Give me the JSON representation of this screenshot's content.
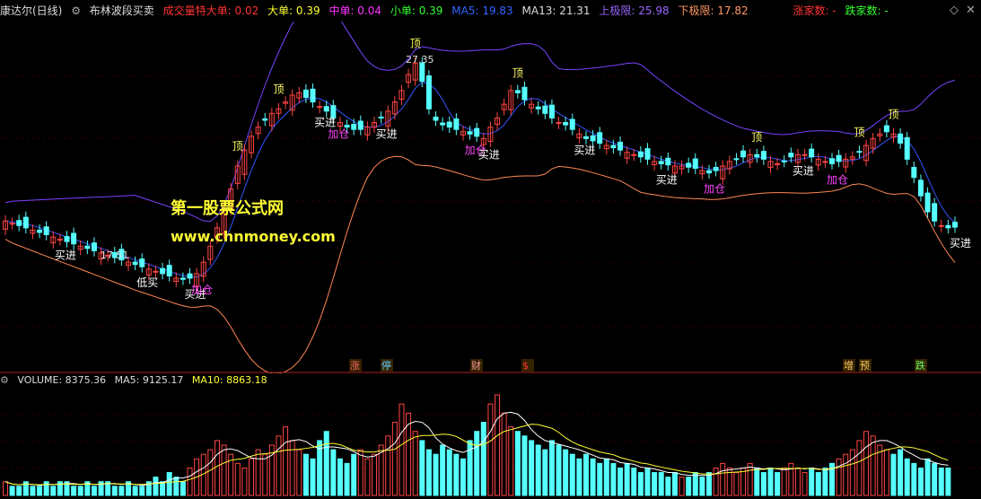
{
  "header": {
    "title": "康达尔(日线)",
    "formula": "布林波段买卖",
    "extra_large": "成交量特大单: 0.02",
    "large": "大单: 0.39",
    "medium": "中单: 0.04",
    "small": "小单: 0.39",
    "ma5": "MA5: 19.83",
    "ma13": "MA13: 21.31",
    "upper": "上极限: 25.98",
    "lower": "下极限: 17.82",
    "up_count": "涨家数: -",
    "down_count": "跌家数: -",
    "colors": {
      "title": "#dddddd",
      "extra_large": "#ff3333",
      "large": "#ffff33",
      "medium": "#ff33ff",
      "small": "#33ff33",
      "ma5": "#3366ff",
      "ma13": "#dddddd",
      "upper": "#9966ff",
      "lower": "#ff9966",
      "up_count": "#ff3333",
      "down_count": "#33ff33"
    }
  },
  "watermark": {
    "line1": "第一股票公式网",
    "line2": "www.chnmoney.com"
  },
  "price_labels": {
    "high": "27.35",
    "low": "17.51"
  },
  "signals": {
    "top": "顶",
    "buy": "买进",
    "add": "加仓",
    "low_buy": "低买"
  },
  "event_markers": [
    "涨",
    "停",
    "财",
    "$",
    "增",
    "预",
    "跌"
  ],
  "volume_header": {
    "volume": "VOLUME: 8375.36",
    "ma5": "MA5: 9125.17",
    "ma10": "MA10: 8863.18"
  },
  "chart_data": {
    "type": "candlestick",
    "closes": [
      20.1,
      20.0,
      19.9,
      19.8,
      19.7,
      19.6,
      19.5,
      19.4,
      19.3,
      19.2,
      19.1,
      19.0,
      18.9,
      18.8,
      18.7,
      18.6,
      18.5,
      18.4,
      18.3,
      18.2,
      18.1,
      18.0,
      17.9,
      17.8,
      17.7,
      17.6,
      17.55,
      17.6,
      17.8,
      18.3,
      19.0,
      19.8,
      20.6,
      21.5,
      22.5,
      23.2,
      23.8,
      24.2,
      24.5,
      24.8,
      25.0,
      25.3,
      25.6,
      25.7,
      25.5,
      25.3,
      25.1,
      24.9,
      24.6,
      24.4,
      24.2,
      24.1,
      24.1,
      24.2,
      24.4,
      24.6,
      24.9,
      25.3,
      25.8,
      26.5,
      27.0,
      26.2,
      25.0,
      24.5,
      24.3,
      24.2,
      24.1,
      24.0,
      23.9,
      23.8,
      23.7,
      24.2,
      24.6,
      25.2,
      25.8,
      25.7,
      25.4,
      25.2,
      25.0,
      24.8,
      24.6,
      24.4,
      24.3,
      24.1,
      23.9,
      23.7,
      23.6,
      23.5,
      23.4,
      23.3,
      23.2,
      23.1,
      23.0,
      22.9,
      22.8,
      22.7,
      22.6,
      22.55,
      22.5,
      22.5,
      22.45,
      22.4,
      22.3,
      22.2,
      22.3,
      22.5,
      22.7,
      22.8,
      22.9,
      23.0,
      22.9,
      22.8,
      22.7,
      22.6,
      22.7,
      22.9,
      23.0,
      23.0,
      22.9,
      22.8,
      22.7,
      22.6,
      22.7,
      22.8,
      22.9,
      23.1,
      23.4,
      23.7,
      23.9,
      24.0,
      23.9,
      23.5,
      22.8,
      22.0,
      21.2,
      20.5,
      20.1,
      19.9,
      19.8,
      19.83
    ],
    "volumes": [
      3,
      2,
      2,
      3,
      2,
      2,
      3,
      2,
      3,
      3,
      2,
      2,
      3,
      2,
      3,
      3,
      2,
      2,
      3,
      2,
      2,
      3,
      4,
      3,
      5,
      4,
      3,
      6,
      8,
      9,
      10,
      12,
      11,
      9,
      7,
      6,
      8,
      10,
      9,
      11,
      13,
      15,
      12,
      10,
      9,
      8,
      12,
      14,
      10,
      8,
      7,
      9,
      10,
      8,
      9,
      11,
      13,
      16,
      20,
      18,
      14,
      12,
      10,
      9,
      11,
      10,
      9,
      8,
      12,
      14,
      16,
      20,
      22,
      18,
      15,
      14,
      13,
      12,
      11,
      10,
      12,
      11,
      10,
      9,
      8,
      9,
      8,
      7,
      8,
      7,
      6,
      7,
      6,
      5,
      6,
      5,
      5,
      4,
      5,
      4,
      4,
      5,
      4,
      5,
      6,
      7,
      6,
      5,
      6,
      7,
      6,
      5,
      6,
      5,
      6,
      7,
      6,
      5,
      6,
      5,
      6,
      7,
      8,
      9,
      10,
      12,
      14,
      13,
      11,
      10,
      9,
      10,
      8,
      7,
      6,
      8,
      7,
      6,
      6
    ],
    "ma5_label": "MA5",
    "ma10_label": "MA10"
  }
}
